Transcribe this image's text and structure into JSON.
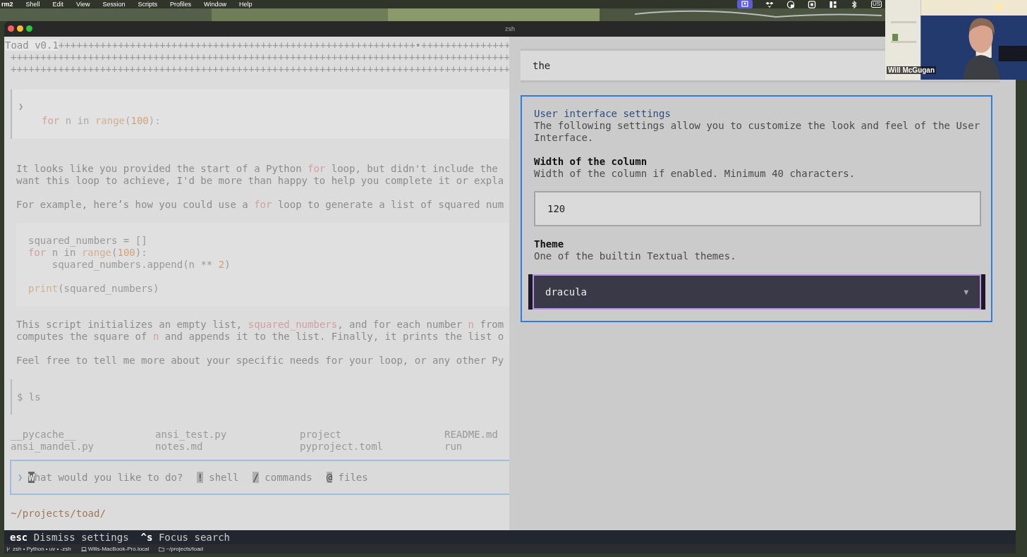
{
  "menubar": {
    "app": "rm2",
    "items": [
      "Shell",
      "Edit",
      "View",
      "Session",
      "Scripts",
      "Profiles",
      "Window",
      "Help"
    ],
    "input_source": "US"
  },
  "window": {
    "title": "zsh"
  },
  "header": {
    "title": "Toad v0.1",
    "rows": [
      "++++++++++++++++++++++++++++++++++++++++++++++++++++++++++++•+++++++++++++++",
      "++++++++++++++++++++++++++++++++++++++++++++++++++++++++++++++++++++++++++++++++++++",
      "++++++++++++++++++++++++++++++++++++++++++++++++++++++++++++++++++++++++++++++++++++"
    ]
  },
  "prompt": {
    "marker": "❯",
    "code": [
      {
        "kind": "keyword",
        "text": "for"
      },
      {
        "kind": "plain",
        "text": " n in "
      },
      {
        "kind": "builtin",
        "text": "range"
      },
      {
        "kind": "plain",
        "text": "("
      },
      {
        "kind": "number",
        "text": "100"
      },
      {
        "kind": "plain",
        "text": "):"
      }
    ]
  },
  "response": [
    [
      [
        {
          "kind": "plain",
          "text": "It looks like you provided the start of a Python "
        },
        {
          "kind": "keyword",
          "text": "for"
        },
        {
          "kind": "plain",
          "text": " loop, but didn't include the"
        }
      ],
      [
        {
          "kind": "plain",
          "text": "want this loop to achieve, I'd be more than happy to help you complete it or expla"
        }
      ]
    ],
    [
      [
        {
          "kind": "plain",
          "text": "For example, here’s how you could use a "
        },
        {
          "kind": "keyword",
          "text": "for"
        },
        {
          "kind": "plain",
          "text": " loop to generate a list of squared num"
        }
      ]
    ]
  ],
  "code_block": [
    [
      [
        {
          "kind": "plain",
          "text": "squared_numbers = []"
        }
      ],
      [
        {
          "kind": "keyword",
          "text": "for"
        },
        {
          "kind": "plain",
          "text": " n in "
        },
        {
          "kind": "builtin",
          "text": "range"
        },
        {
          "kind": "plain",
          "text": "("
        },
        {
          "kind": "number",
          "text": "100"
        },
        {
          "kind": "plain",
          "text": "):"
        }
      ],
      [
        {
          "kind": "plain",
          "text": "    squared_numbers.append(n ** "
        },
        {
          "kind": "number",
          "text": "2"
        },
        {
          "kind": "plain",
          "text": ")"
        }
      ]
    ],
    [
      [
        {
          "kind": "builtin",
          "text": "print"
        },
        {
          "kind": "plain",
          "text": "(squared_numbers)"
        }
      ]
    ]
  ],
  "response_after": [
    [
      [
        {
          "kind": "plain",
          "text": "This script initializes an empty list, "
        },
        {
          "kind": "keyword",
          "text": "squared_numbers"
        },
        {
          "kind": "plain",
          "text": ", and for each number "
        },
        {
          "kind": "keyword",
          "text": "n"
        },
        {
          "kind": "plain",
          "text": " from"
        }
      ],
      [
        {
          "kind": "plain",
          "text": "computes the square of "
        },
        {
          "kind": "keyword",
          "text": "n"
        },
        {
          "kind": "plain",
          "text": " and appends it to the list. Finally, it prints the list o"
        }
      ]
    ],
    [
      [
        {
          "kind": "plain",
          "text": "Feel free to tell me more about your specific needs for your loop, or any other Py"
        }
      ]
    ]
  ],
  "shell": {
    "marker": "$",
    "command": "ls"
  },
  "ls_output": [
    [
      "__pycache__",
      "ansi_test.py",
      "project",
      "README.md"
    ],
    [
      "ansi_mandel.py",
      "notes.md",
      "pyproject.toml",
      "run"
    ]
  ],
  "input": {
    "marker": "❯",
    "placeholder": "What would you like to do?",
    "hints": [
      {
        "key": "!",
        "label": "shell"
      },
      {
        "key": "/",
        "label": "commands"
      },
      {
        "key": "@",
        "label": "files"
      }
    ]
  },
  "cwd": "~/projects/toad/",
  "search": {
    "value": "the"
  },
  "settings": {
    "title": "User interface settings",
    "description": "The following settings allow you to customize the look and feel of the User Interface.",
    "fields": [
      {
        "kind": "input",
        "label": "Width of the column",
        "help": "Width of the column if enabled. Minimum 40 characters.",
        "value": "120"
      },
      {
        "kind": "select",
        "label": "Theme",
        "help": "One of the builtin Textual themes.",
        "value": "dracula",
        "arrow": "▼"
      }
    ]
  },
  "footer": [
    {
      "key": "esc",
      "label": "Dismiss settings"
    },
    {
      "key": "^s",
      "label": "Focus search"
    }
  ],
  "status_bar": [
    "zsh • Python • uv • -zsh",
    "Wills-MacBook-Pro.local",
    "~/projects/toad"
  ],
  "video": {
    "name": "Will McGugan"
  }
}
